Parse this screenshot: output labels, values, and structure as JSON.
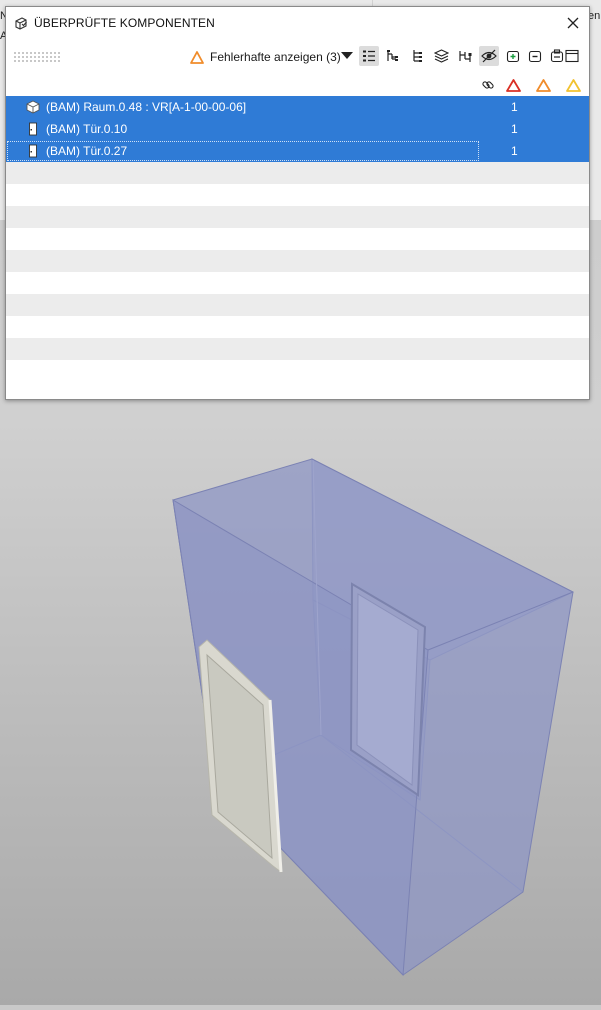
{
  "dialog": {
    "title": "ÜBERPRÜFTE KOMPONENTEN",
    "filter_label": "Fehlerhafte anzeigen (3)"
  },
  "background": {
    "left_fragments": [
      "N",
      "A"
    ],
    "right_fragment": "en"
  },
  "toolbar": {
    "buttons": [
      {
        "name": "list-view-icon",
        "active": true
      },
      {
        "name": "tree-view-icon",
        "active": false
      },
      {
        "name": "hierarchy-icon",
        "active": false
      },
      {
        "name": "layers-icon",
        "active": false
      },
      {
        "name": "network-icon",
        "active": false
      },
      {
        "name": "visibility-icon",
        "active": true
      },
      {
        "name": "add-component-icon",
        "active": false
      },
      {
        "name": "remove-component-icon",
        "active": false
      },
      {
        "name": "clipboard-icon",
        "active": false
      },
      {
        "name": "window-icon",
        "active": false
      }
    ]
  },
  "columns": [
    {
      "name": "link-icon"
    },
    {
      "name": "error-icon",
      "color": "#d93025"
    },
    {
      "name": "warning-icon",
      "color": "#f08c2b"
    },
    {
      "name": "info-icon",
      "color": "#f2c230"
    }
  ],
  "rows": [
    {
      "label": "(BAM) Raum.0.48 : VR[A-1-00-00-06]",
      "count": "1",
      "icon": "cube-icon",
      "selected": true
    },
    {
      "label": "(BAM) Tür.0.10",
      "count": "1",
      "icon": "door-icon",
      "selected": true
    },
    {
      "label": "(BAM) Tür.0.27",
      "count": "1",
      "icon": "door-icon",
      "selected": true
    }
  ],
  "colors": {
    "selection": "#2f7bd6",
    "room_fill": "#8e95c4"
  }
}
